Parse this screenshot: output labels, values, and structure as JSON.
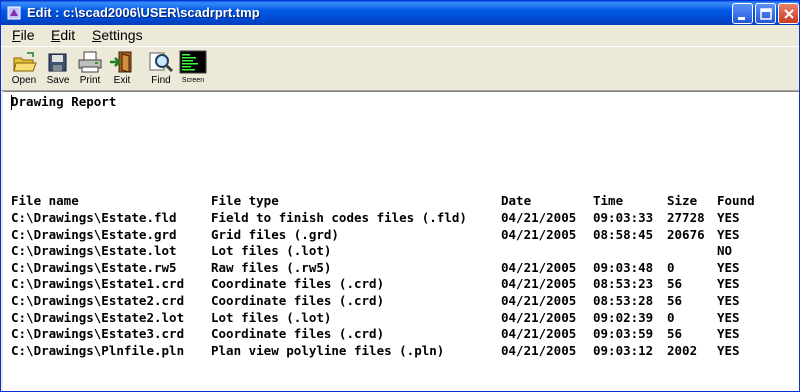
{
  "window": {
    "title": "Edit : c:\\scad2006\\USER\\scadrprt.tmp",
    "controls": [
      "minimize",
      "maximize",
      "close"
    ]
  },
  "menu": [
    {
      "label": "File",
      "underline": "F",
      "rest": "ile"
    },
    {
      "label": "Edit",
      "underline": "E",
      "rest": "dit"
    },
    {
      "label": "Settings",
      "underline": "S",
      "rest": "ettings"
    }
  ],
  "toolbar": {
    "open": "Open",
    "save": "Save",
    "print": "Print",
    "exit": "Exit",
    "find": "Find",
    "screen": "Screen"
  },
  "report": {
    "heading": "Drawing Report",
    "columns": {
      "file_name": "File name",
      "file_type": "File type",
      "date": "Date",
      "time": "Time",
      "size": "Size",
      "found": "Found"
    },
    "rows": [
      {
        "file_name": "C:\\Drawings\\Estate.fld",
        "file_type": "Field to finish codes files (.fld)",
        "date": "04/21/2005",
        "time": "09:03:33",
        "size": "27728",
        "found": "YES"
      },
      {
        "file_name": "C:\\Drawings\\Estate.grd",
        "file_type": "Grid files (.grd)",
        "date": "04/21/2005",
        "time": "08:58:45",
        "size": "20676",
        "found": "YES"
      },
      {
        "file_name": "C:\\Drawings\\Estate.lot",
        "file_type": "Lot files (.lot)",
        "date": "",
        "time": "",
        "size": "",
        "found": "NO"
      },
      {
        "file_name": "C:\\Drawings\\Estate.rw5",
        "file_type": "Raw files (.rw5)",
        "date": "04/21/2005",
        "time": "09:03:48",
        "size": "0",
        "found": "YES"
      },
      {
        "file_name": "C:\\Drawings\\Estate1.crd",
        "file_type": "Coordinate files (.crd)",
        "date": "04/21/2005",
        "time": "08:53:23",
        "size": "56",
        "found": "YES"
      },
      {
        "file_name": "C:\\Drawings\\Estate2.crd",
        "file_type": "Coordinate files (.crd)",
        "date": "04/21/2005",
        "time": "08:53:28",
        "size": "56",
        "found": "YES"
      },
      {
        "file_name": "C:\\Drawings\\Estate2.lot",
        "file_type": "Lot files (.lot)",
        "date": "04/21/2005",
        "time": "09:02:39",
        "size": "0",
        "found": "YES"
      },
      {
        "file_name": "C:\\Drawings\\Estate3.crd",
        "file_type": "Coordinate files (.crd)",
        "date": "04/21/2005",
        "time": "09:03:59",
        "size": "56",
        "found": "YES"
      },
      {
        "file_name": "C:\\Drawings\\Plnfile.pln",
        "file_type": "Plan view polyline files (.pln)",
        "date": "04/21/2005",
        "time": "09:03:12",
        "size": "2002",
        "found": "YES"
      }
    ]
  }
}
